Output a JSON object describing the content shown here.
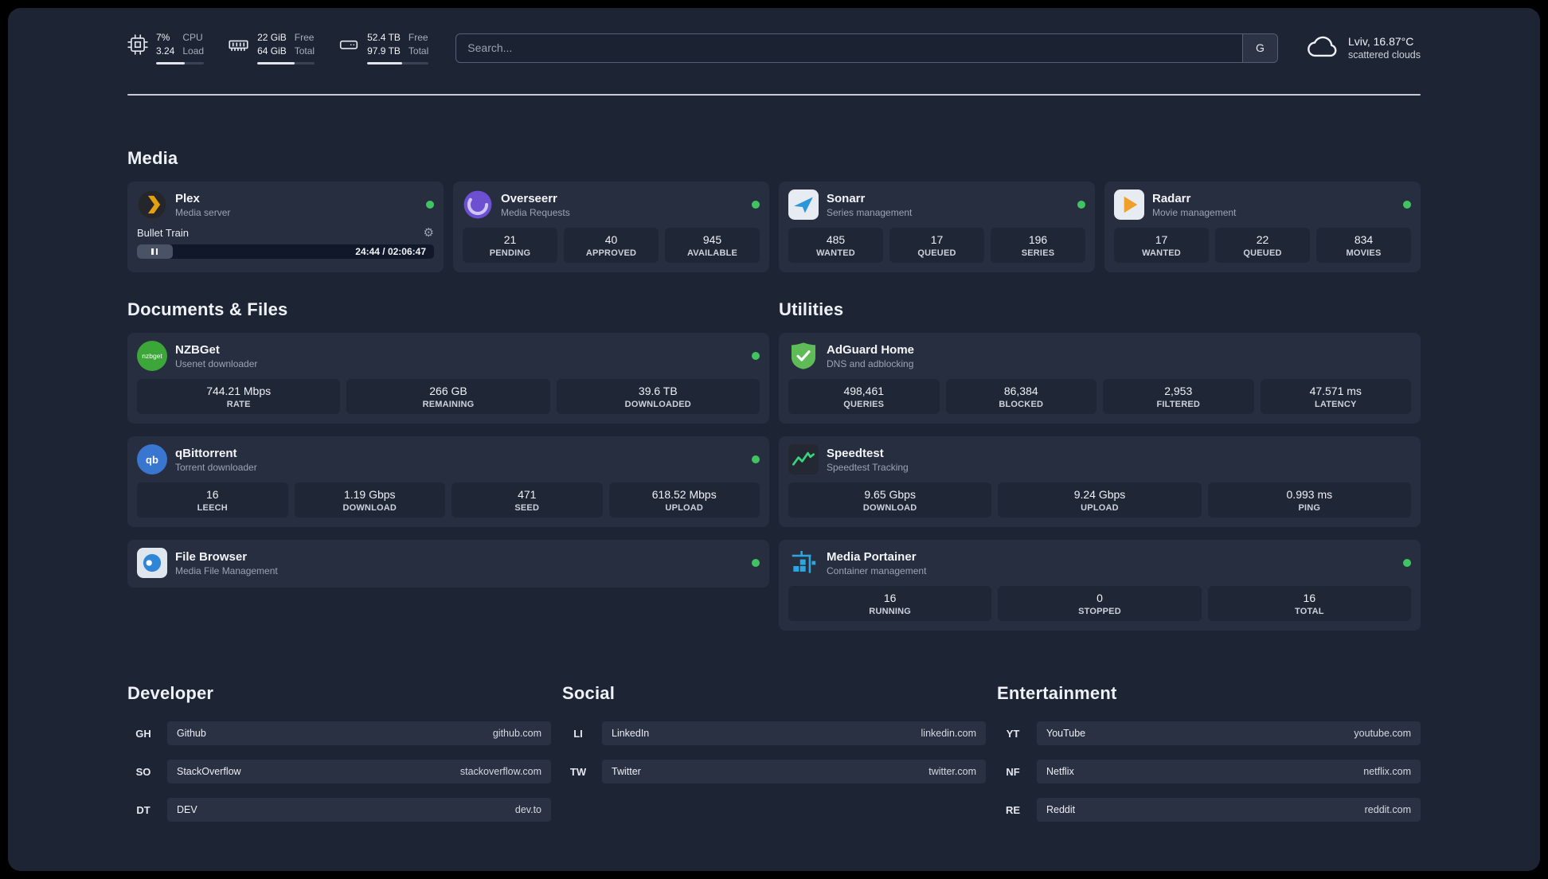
{
  "topbar": {
    "cpu": {
      "value": "7%",
      "sub": "3.24",
      "label1": "CPU",
      "label2": "Load",
      "progress": "60%"
    },
    "ram": {
      "value": "22 GiB",
      "sub": "64 GiB",
      "label1": "Free",
      "label2": "Total",
      "progress": "65%"
    },
    "disk": {
      "value": "52.4 TB",
      "sub": "97.9 TB",
      "label1": "Free",
      "label2": "Total",
      "progress": "57%"
    },
    "search": {
      "placeholder": "Search...",
      "engine": "G"
    },
    "weather": {
      "location": "Lviv, 16.87°C",
      "condition": "scattered clouds"
    }
  },
  "media": {
    "title": "Media",
    "plex": {
      "name": "Plex",
      "subtitle": "Media server",
      "now_playing": "Bullet Train",
      "time": "24:44 / 02:06:47",
      "progress": "12%"
    },
    "overseerr": {
      "name": "Overseerr",
      "subtitle": "Media Requests",
      "stats": [
        {
          "value": "21",
          "label": "PENDING"
        },
        {
          "value": "40",
          "label": "APPROVED"
        },
        {
          "value": "945",
          "label": "AVAILABLE"
        }
      ]
    },
    "sonarr": {
      "name": "Sonarr",
      "subtitle": "Series management",
      "stats": [
        {
          "value": "485",
          "label": "WANTED"
        },
        {
          "value": "17",
          "label": "QUEUED"
        },
        {
          "value": "196",
          "label": "SERIES"
        }
      ]
    },
    "radarr": {
      "name": "Radarr",
      "subtitle": "Movie management",
      "stats": [
        {
          "value": "17",
          "label": "WANTED"
        },
        {
          "value": "22",
          "label": "QUEUED"
        },
        {
          "value": "834",
          "label": "MOVIES"
        }
      ]
    }
  },
  "documents": {
    "title": "Documents & Files",
    "nzbget": {
      "name": "NZBGet",
      "subtitle": "Usenet downloader",
      "icon_text": "nzbget",
      "stats": [
        {
          "value": "744.21 Mbps",
          "label": "RATE"
        },
        {
          "value": "266 GB",
          "label": "REMAINING"
        },
        {
          "value": "39.6 TB",
          "label": "DOWNLOADED"
        }
      ]
    },
    "qbittorrent": {
      "name": "qBittorrent",
      "subtitle": "Torrent downloader",
      "icon_text": "qb",
      "stats": [
        {
          "value": "16",
          "label": "LEECH"
        },
        {
          "value": "1.19 Gbps",
          "label": "DOWNLOAD"
        },
        {
          "value": "471",
          "label": "SEED"
        },
        {
          "value": "618.52 Mbps",
          "label": "UPLOAD"
        }
      ]
    },
    "filebrowser": {
      "name": "File Browser",
      "subtitle": "Media File Management"
    }
  },
  "utilities": {
    "title": "Utilities",
    "adguard": {
      "name": "AdGuard Home",
      "subtitle": "DNS and adblocking",
      "stats": [
        {
          "value": "498,461",
          "label": "QUERIES"
        },
        {
          "value": "86,384",
          "label": "BLOCKED"
        },
        {
          "value": "2,953",
          "label": "FILTERED"
        },
        {
          "value": "47.571 ms",
          "label": "LATENCY"
        }
      ]
    },
    "speedtest": {
      "name": "Speedtest",
      "subtitle": "Speedtest Tracking",
      "stats": [
        {
          "value": "9.65 Gbps",
          "label": "DOWNLOAD"
        },
        {
          "value": "9.24 Gbps",
          "label": "UPLOAD"
        },
        {
          "value": "0.993 ms",
          "label": "PING"
        }
      ]
    },
    "portainer": {
      "name": "Media Portainer",
      "subtitle": "Container management",
      "stats": [
        {
          "value": "16",
          "label": "RUNNING"
        },
        {
          "value": "0",
          "label": "STOPPED"
        },
        {
          "value": "16",
          "label": "TOTAL"
        }
      ]
    }
  },
  "developer": {
    "title": "Developer",
    "links": [
      {
        "abbr": "GH",
        "name": "Github",
        "url": "github.com"
      },
      {
        "abbr": "SO",
        "name": "StackOverflow",
        "url": "stackoverflow.com"
      },
      {
        "abbr": "DT",
        "name": "DEV",
        "url": "dev.to"
      }
    ]
  },
  "social": {
    "title": "Social",
    "links": [
      {
        "abbr": "LI",
        "name": "LinkedIn",
        "url": "linkedin.com"
      },
      {
        "abbr": "TW",
        "name": "Twitter",
        "url": "twitter.com"
      }
    ]
  },
  "entertainment": {
    "title": "Entertainment",
    "links": [
      {
        "abbr": "YT",
        "name": "YouTube",
        "url": "youtube.com"
      },
      {
        "abbr": "NF",
        "name": "Netflix",
        "url": "netflix.com"
      },
      {
        "abbr": "RE",
        "name": "Reddit",
        "url": "reddit.com"
      }
    ]
  },
  "colors": {
    "status_green": "#40c463",
    "plex_amber": "#e5a00d",
    "adguard_green": "#5fbb57",
    "portainer_blue": "#2aa7e0",
    "speedtest_green": "#37d67a",
    "page_bg": "#1d2433",
    "card_bg": "#272e3f"
  }
}
